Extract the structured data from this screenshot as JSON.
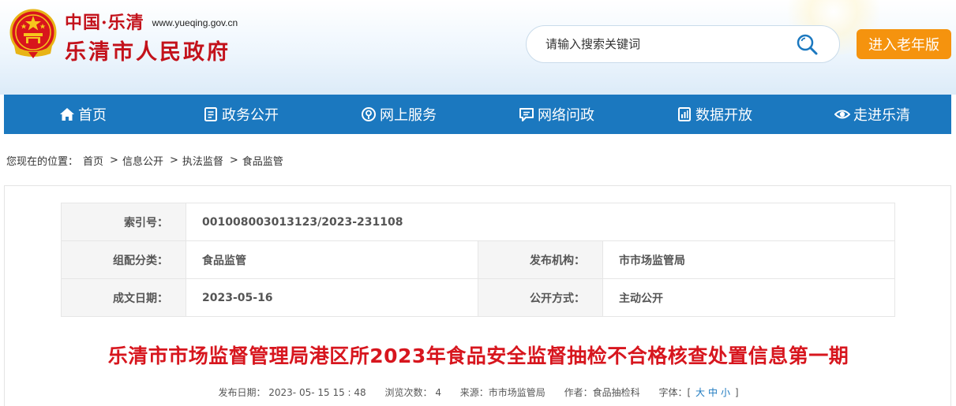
{
  "header": {
    "site_prefix": "中国·乐清",
    "site_url": "www.yueqing.gov.cn",
    "site_name": "乐清市人民政府",
    "search_placeholder": "请输入搜索关键词",
    "elder_button": "进入老年版"
  },
  "nav": {
    "items": [
      {
        "label": "首页",
        "icon": "home-icon"
      },
      {
        "label": "政务公开",
        "icon": "document-icon"
      },
      {
        "label": "网上服务",
        "icon": "service-icon"
      },
      {
        "label": "网络问政",
        "icon": "chat-icon"
      },
      {
        "label": "数据开放",
        "icon": "data-icon"
      },
      {
        "label": "走进乐清",
        "icon": "eye-icon"
      }
    ]
  },
  "breadcrumb": {
    "prefix": "您现在的位置：",
    "items": [
      "首页",
      "信息公开",
      "执法监督",
      "食品监管"
    ],
    "separator": ">"
  },
  "meta": {
    "index_label": "索引号：",
    "index_value": "001008003013123/2023-231108",
    "category_label": "组配分类：",
    "category_value": "食品监管",
    "publisher_label": "发布机构：",
    "publisher_value": "市市场监管局",
    "date_label": "成文日期：",
    "date_value": "2023-05-16",
    "method_label": "公开方式：",
    "method_value": "主动公开"
  },
  "article": {
    "title": "乐清市市场监督管理局港区所2023年食品安全监督抽检不合格核查处置信息第一期",
    "publish_date": "发布日期： 2023- 05- 15 15 : 48",
    "views": "浏览次数： 4",
    "source": "来源：市市场监管局",
    "author": "作者：食品抽检科",
    "font_label": "字体：[",
    "font_large": "大",
    "font_medium": "中",
    "font_small": "小",
    "font_close": "]"
  },
  "colors": {
    "nav_bg": "#1b78bf",
    "title_red": "#d7161e",
    "elder_orange": "#f5930e"
  }
}
